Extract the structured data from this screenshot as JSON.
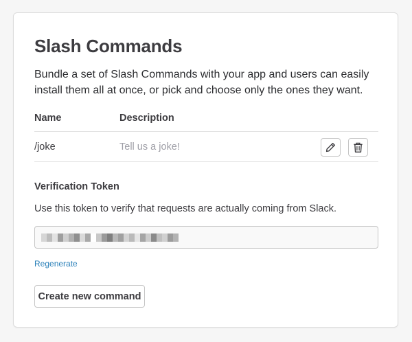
{
  "header": {
    "title": "Slash Commands",
    "intro": "Bundle a set of Slash Commands with your app and users can easily install them all at once, or pick and choose only the ones they want."
  },
  "table": {
    "columns": [
      "Name",
      "Description"
    ],
    "rows": [
      {
        "command": "/joke",
        "description": "Tell us a joke!",
        "actions": [
          "pencil-icon",
          "trash-icon"
        ]
      }
    ]
  },
  "verification": {
    "title": "Verification Token",
    "help": "Use this token to verify that requests are actually coming from Slack.",
    "regenerate_label": "Regenerate"
  },
  "actions": {
    "create_label": "Create new command"
  },
  "colors": {
    "link": "#2a80b9",
    "border": "#c5c5c5",
    "muted_text": "#9e9ea6",
    "background": "#f6f6f6"
  }
}
